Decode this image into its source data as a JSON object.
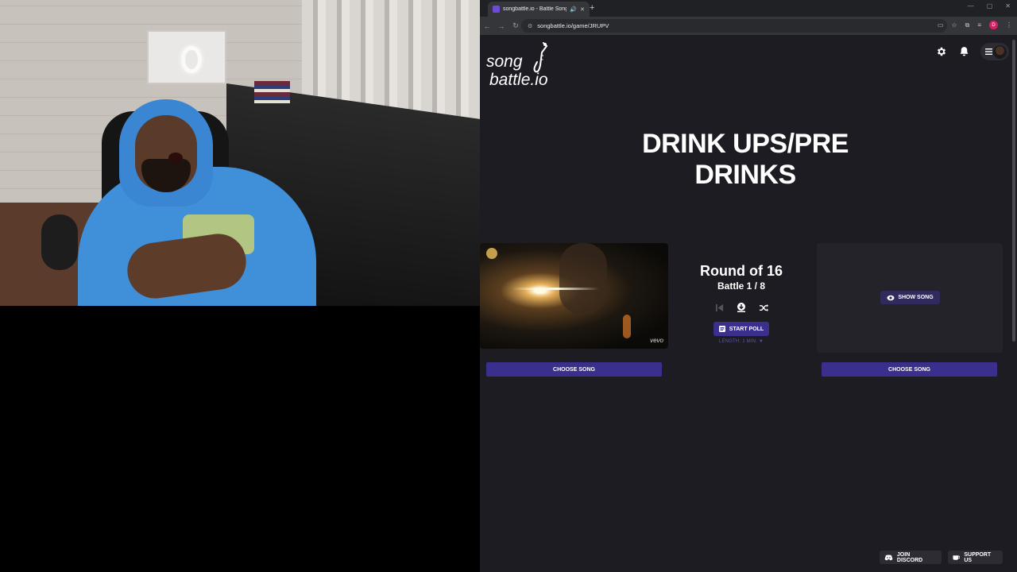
{
  "browser": {
    "tab_title": "songbattle.io - Battle Songs",
    "new_tab_icon": "+",
    "url": "songbattle.io/game/JRUPV",
    "profile_initial": "D",
    "window_controls": [
      "—",
      "▢",
      "✕"
    ]
  },
  "app": {
    "logo_line1": "song",
    "logo_line2": "battle.io",
    "game_title": "DRINK UPS/PRE DRINKS",
    "round_title": "Round of 16",
    "battle_label": "Battle 1 / 8",
    "start_poll_label": "START POLL",
    "poll_length_label": "LENGTH: 1 MIN. ▼",
    "show_song_label": "SHOW SONG",
    "choose_song_left_label": "CHOOSE SONG",
    "choose_song_right_label": "CHOOSE SONG",
    "join_discord_label": "JOIN DISCORD",
    "support_us_label": "SUPPORT US",
    "video_watermark": "vevo"
  },
  "colors": {
    "page_bg": "#1d1c22",
    "button_primary": "#3a2f8c",
    "accent_text": "#5c57a8"
  },
  "icons": [
    "gear-icon",
    "bell-icon",
    "hamburger-icon",
    "previous-icon",
    "download-icon",
    "shuffle-icon",
    "poll-icon",
    "eye-icon",
    "discord-icon",
    "kofi-icon"
  ]
}
